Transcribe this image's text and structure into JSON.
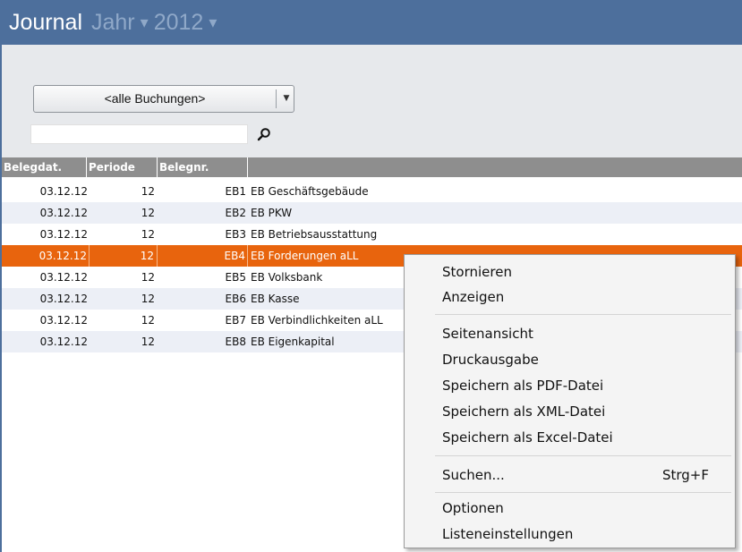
{
  "title": {
    "main": "Journal",
    "year_label": "Jahr",
    "year": "2012"
  },
  "filter": {
    "selected": "<alle Buchungen>"
  },
  "search": {
    "value": "",
    "placeholder": ""
  },
  "table": {
    "columns": [
      "Belegdat.",
      "Periode",
      "Belegnr.",
      ""
    ],
    "rows": [
      {
        "date": "03.12.12",
        "period": "12",
        "nr": "EB1",
        "text": "EB Geschäftsgebäude"
      },
      {
        "date": "03.12.12",
        "period": "12",
        "nr": "EB2",
        "text": "EB PKW"
      },
      {
        "date": "03.12.12",
        "period": "12",
        "nr": "EB3",
        "text": "EB Betriebsausstattung"
      },
      {
        "date": "03.12.12",
        "period": "12",
        "nr": "EB4",
        "text": "EB Forderungen aLL"
      },
      {
        "date": "03.12.12",
        "period": "12",
        "nr": "EB5",
        "text": "EB Volksbank"
      },
      {
        "date": "03.12.12",
        "period": "12",
        "nr": "EB6",
        "text": "EB Kasse"
      },
      {
        "date": "03.12.12",
        "period": "12",
        "nr": "EB7",
        "text": "EB Verbindlichkeiten aLL"
      },
      {
        "date": "03.12.12",
        "period": "12",
        "nr": "EB8",
        "text": "EB Eigenkapital"
      }
    ]
  },
  "context_menu": {
    "items": [
      {
        "label": "Stornieren"
      },
      {
        "label": "Anzeigen"
      },
      {
        "label": "Seitenansicht"
      },
      {
        "label": "Druckausgabe"
      },
      {
        "label": "Speichern als PDF-Datei"
      },
      {
        "label": "Speichern als XML-Datei"
      },
      {
        "label": "Speichern als Excel-Datei"
      },
      {
        "label": "Suchen...",
        "shortcut": "Strg+F"
      },
      {
        "label": "Optionen"
      },
      {
        "label": "Listeneinstellungen"
      }
    ]
  },
  "colors": {
    "header": "#4d6f9c",
    "selection": "#e8640d",
    "grid_header": "#8e8e8e"
  },
  "icons": {
    "search": "magnifier-icon",
    "dropdown": "chevron-down-icon",
    "title_caret": "caret-down-icon"
  }
}
